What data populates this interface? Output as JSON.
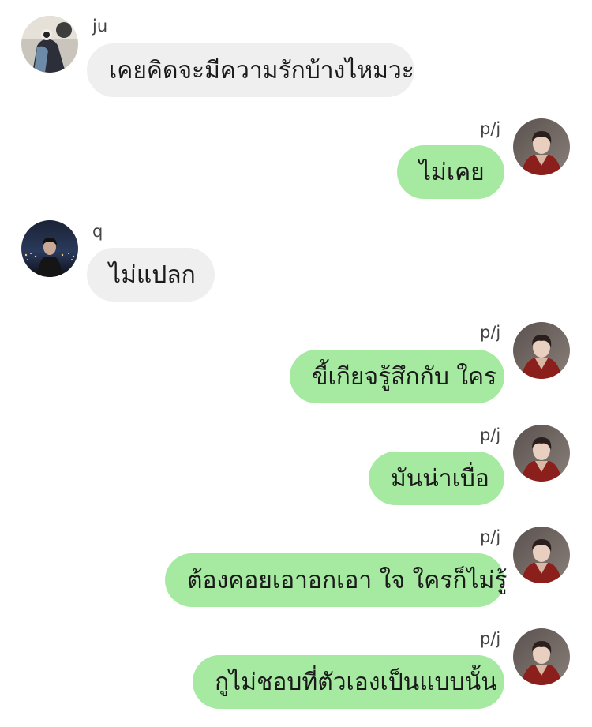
{
  "colors": {
    "incoming_bubble": "#efefef",
    "outgoing_bubble": "#a6e9a1",
    "text": "#1a1a1a",
    "sender_name": "#444444"
  },
  "messages": [
    {
      "sender": "ju",
      "text": "เคยคิดจะมีความรักบ้างไหมวะ",
      "direction": "incoming",
      "avatar": "avatar-ju"
    },
    {
      "sender": "p/j",
      "text": "ไม่เคย",
      "direction": "outgoing",
      "avatar": "avatar-pj"
    },
    {
      "sender": "q",
      "text": "ไม่แปลก",
      "direction": "incoming",
      "avatar": "avatar-q"
    },
    {
      "sender": "p/j",
      "text": "ขี้เกียจรู้สึกกับ ใคร",
      "direction": "outgoing",
      "avatar": "avatar-pj"
    },
    {
      "sender": "p/j",
      "text": "มันน่าเบื่อ",
      "direction": "outgoing",
      "avatar": "avatar-pj"
    },
    {
      "sender": "p/j",
      "text": "ต้องคอยเอาอกเอา ใจ ใครก็ไม่รู้",
      "direction": "outgoing",
      "avatar": "avatar-pj"
    },
    {
      "sender": "p/j",
      "text": "กูไม่ชอบที่ตัวเองเป็นแบบนั้น",
      "direction": "outgoing",
      "avatar": "avatar-pj"
    }
  ]
}
